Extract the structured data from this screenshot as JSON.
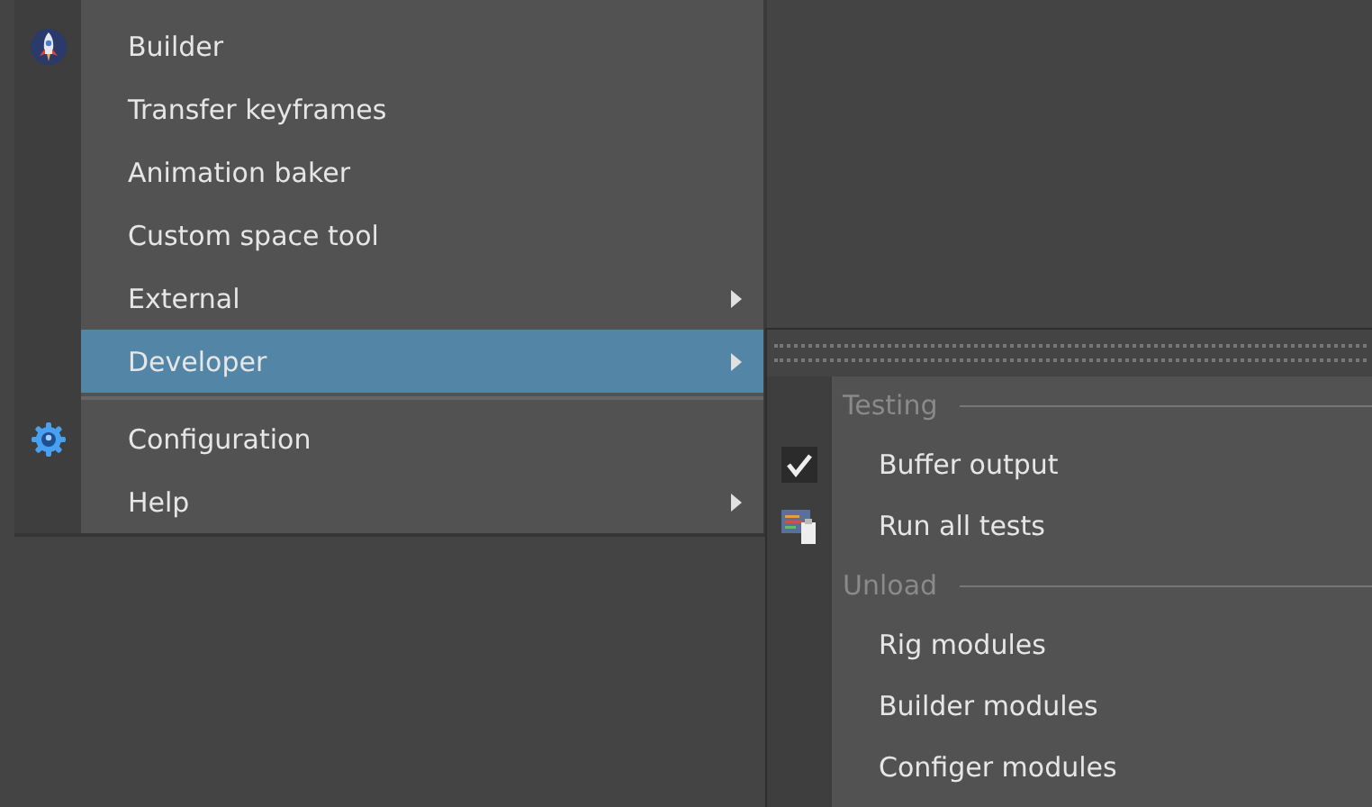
{
  "menu": {
    "items": [
      {
        "kind": "item",
        "label": "Builder",
        "submenu": false,
        "selected": false
      },
      {
        "kind": "item",
        "label": "Transfer keyframes",
        "submenu": false,
        "selected": false
      },
      {
        "kind": "item",
        "label": "Animation baker",
        "submenu": false,
        "selected": false
      },
      {
        "kind": "item",
        "label": "Custom space tool",
        "submenu": false,
        "selected": false
      },
      {
        "kind": "item",
        "label": "External",
        "submenu": true,
        "selected": false
      },
      {
        "kind": "item",
        "label": "Developer",
        "submenu": true,
        "selected": true
      },
      {
        "kind": "separator"
      },
      {
        "kind": "item",
        "label": "Configuration",
        "submenu": false,
        "selected": false
      },
      {
        "kind": "item",
        "label": "Help",
        "submenu": true,
        "selected": false
      }
    ]
  },
  "submenu": {
    "items": [
      {
        "kind": "section",
        "label": "Testing"
      },
      {
        "kind": "item",
        "label": "Buffer output",
        "checked": true
      },
      {
        "kind": "item",
        "label": "Run all tests"
      },
      {
        "kind": "section",
        "label": "Unload"
      },
      {
        "kind": "item",
        "label": "Rig modules"
      },
      {
        "kind": "item",
        "label": "Builder modules"
      },
      {
        "kind": "item",
        "label": "Configer modules"
      }
    ]
  }
}
